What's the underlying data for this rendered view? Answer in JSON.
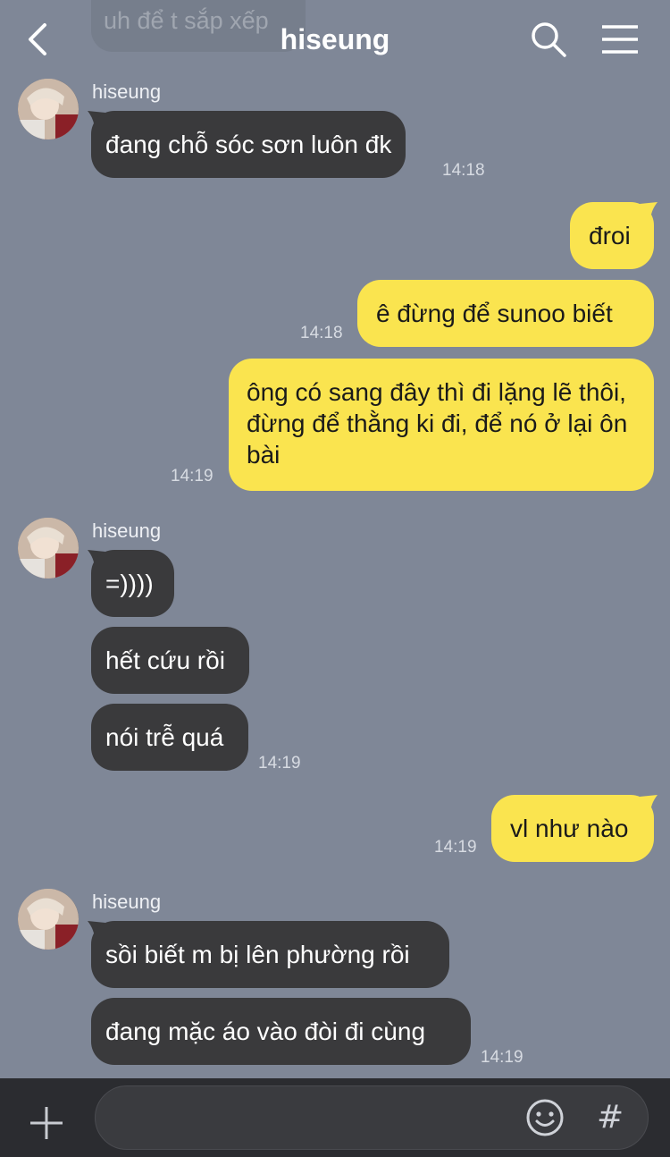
{
  "header": {
    "title": "hiseung",
    "back_icon": "chevron-left-icon",
    "search_icon": "search-icon",
    "menu_icon": "hamburger-menu-icon"
  },
  "previous_message": {
    "text": "uh để t sắp xếp"
  },
  "messages": [
    {
      "sender": "hiseung",
      "direction": "in",
      "text": "đang chỗ sóc sơn luôn đk",
      "time": "14:18"
    },
    {
      "direction": "out",
      "text": "đroi"
    },
    {
      "direction": "out",
      "text": "ê đừng để sunoo biết",
      "time": "14:18"
    },
    {
      "direction": "out",
      "text": "ông có sang đây thì đi lặng lẽ thôi, đừng để thằng ki đi, để nó ở lại ôn bài",
      "time": "14:19"
    },
    {
      "sender": "hiseung",
      "direction": "in",
      "text": "=))))"
    },
    {
      "direction": "in",
      "text": "hết cứu rồi"
    },
    {
      "direction": "in",
      "text": "nói trễ quá",
      "time": "14:19"
    },
    {
      "direction": "out",
      "text": "vl như nào",
      "time": "14:19"
    },
    {
      "sender": "hiseung",
      "direction": "in",
      "text": "sồi biết m bị lên phường rồi"
    },
    {
      "direction": "in",
      "text": "đang mặc áo vào đòi đi cùng",
      "time": "14:19"
    }
  ],
  "input_bar": {
    "placeholder": "",
    "plus_icon": "plus-icon",
    "emoji_icon": "emoji-icon",
    "hashtag_icon": "hashtag-icon",
    "hashtag_glyph": "#"
  },
  "colors": {
    "background": "#7f8797",
    "incoming_bubble": "#3a3a3c",
    "outgoing_bubble": "#fae44f",
    "input_bar": "#2b2c30"
  }
}
